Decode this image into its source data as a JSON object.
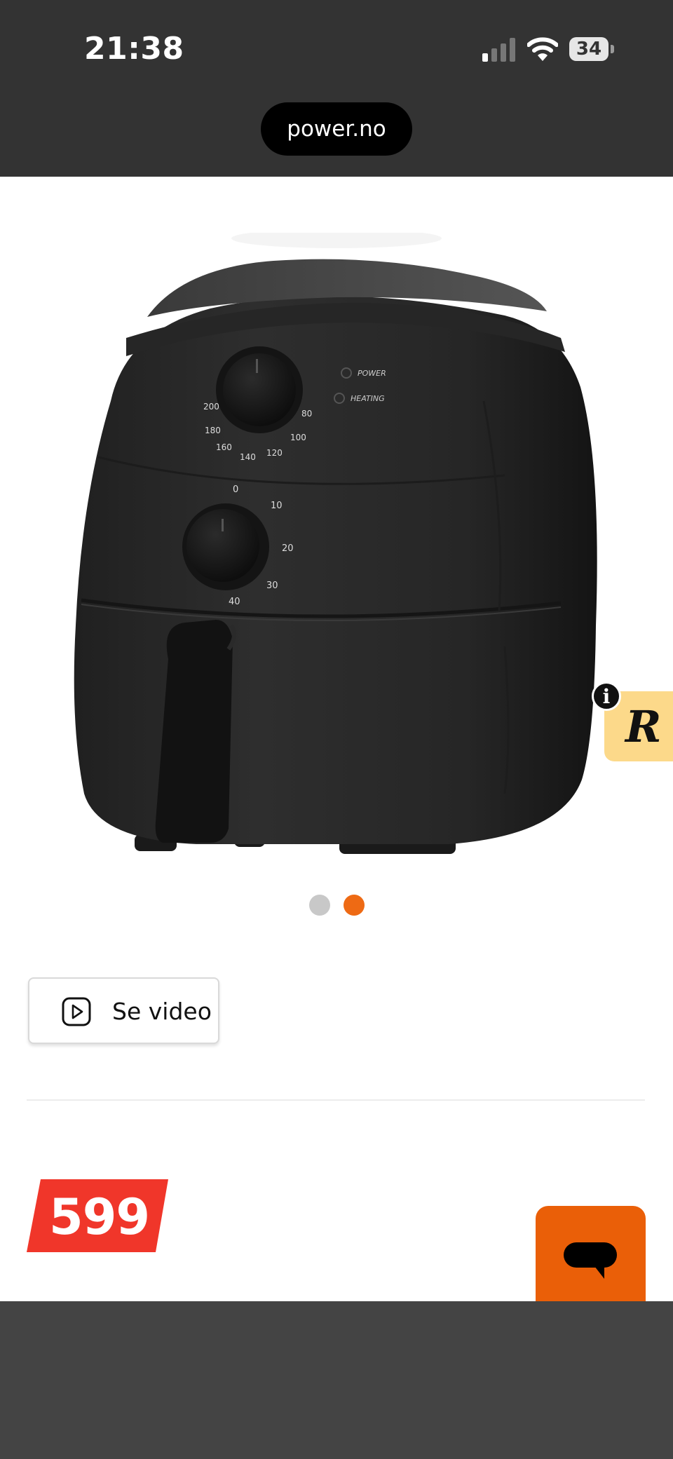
{
  "status_bar": {
    "time": "21:38",
    "battery_level": "34",
    "signal_icon": "cellular-signal-icon",
    "wifi_icon": "wifi-icon"
  },
  "browser": {
    "url": "power.no"
  },
  "product": {
    "image_icon": "air-fryer-product-image",
    "dial_upper_labels": [
      "200",
      "180",
      "160",
      "140",
      "120",
      "100",
      "80"
    ],
    "dial_lower_labels": [
      "0",
      "10",
      "20",
      "30",
      "40"
    ],
    "indicator_power": "POWER",
    "indicator_heating": "HEATING",
    "carousel": {
      "total": 2,
      "active_index": 2
    }
  },
  "video_button": {
    "label": "Se video",
    "icon": "play-icon"
  },
  "price": {
    "value": "599",
    "color": "#f0362a"
  },
  "chat": {
    "icon": "chat-bubble-icon",
    "color": "#ea5f08"
  },
  "badge": {
    "letter": "R",
    "info": "i"
  }
}
